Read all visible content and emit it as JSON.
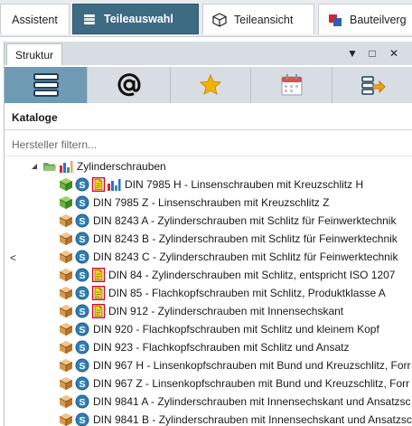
{
  "top_tabs": [
    {
      "label": "Assistent"
    },
    {
      "label": "Teileauswahl"
    },
    {
      "label": "Teileansicht"
    },
    {
      "label": "Bauteilverg"
    }
  ],
  "panel": {
    "tab_label": "Struktur",
    "controls": {
      "menu": "▼",
      "maximize": "□",
      "close": "✕"
    },
    "toolbar_icons": [
      "catalog-books-icon",
      "at-sign-icon",
      "favorites-star-icon",
      "calendar-icon",
      "export-arrow-icon"
    ],
    "section_label": "Kataloge",
    "filter_placeholder": "Hersteller filtern...",
    "scroll_left": "<"
  },
  "tree": {
    "root": {
      "label": "Zylinderschrauben"
    },
    "items": [
      {
        "label": "DIN 7985 H - Linsenschrauben mit Kreuzschlitz H",
        "cube": "green",
        "doc": true,
        "chart": true
      },
      {
        "label": "DIN 7985 Z - Linsenschrauben mit Kreuzschlitz Z",
        "cube": "green",
        "doc": false,
        "chart": false
      },
      {
        "label": "DIN 8243 A - Zylinderschrauben mit Schlitz für Feinwerktechnik",
        "cube": "orange",
        "doc": false,
        "chart": false
      },
      {
        "label": "DIN 8243 B - Zylinderschrauben mit Schlitz für Feinwerktechnik",
        "cube": "orange",
        "doc": false,
        "chart": false
      },
      {
        "label": "DIN 8243 C - Zylinderschrauben mit Schlitz für Feinwerktechnik",
        "cube": "orange",
        "doc": false,
        "chart": false
      },
      {
        "label": "DIN 84 - Zylinderschrauben mit Schlitz, entspricht ISO 1207",
        "cube": "orange",
        "doc": true,
        "chart": false
      },
      {
        "label": "DIN 85 - Flachkopfschrauben mit Schlitz, Produktklasse A",
        "cube": "orange",
        "doc": true,
        "chart": false
      },
      {
        "label": "DIN 912 - Zylinderschrauben mit Innensechskant",
        "cube": "orange",
        "doc": true,
        "chart": false
      },
      {
        "label": "DIN 920 - Flachkopfschrauben mit Schlitz und kleinem Kopf",
        "cube": "orange",
        "doc": false,
        "chart": false
      },
      {
        "label": "DIN 923 - Flachkopfschrauben mit Schlitz und Ansatz",
        "cube": "orange",
        "doc": false,
        "chart": false
      },
      {
        "label": "DIN 967 H - Linsenkopfschrauben mit Bund und Kreuzschlitz, Forr",
        "cube": "orange",
        "doc": false,
        "chart": false
      },
      {
        "label": "DIN 967 Z - Linsenkopfschrauben mit Bund und Kreuzschlitz, Forr",
        "cube": "orange",
        "doc": false,
        "chart": false
      },
      {
        "label": "DIN 9841 A - Zylinderschrauben mit Innensechskant und Ansatzsc",
        "cube": "orange",
        "doc": false,
        "chart": false
      },
      {
        "label": "DIN 9841 B - Zylinderschrauben mit Innensechskant und Ansatzsc",
        "cube": "orange",
        "doc": false,
        "chart": false
      }
    ]
  },
  "colors": {
    "active_tab": "#3e6b84",
    "active_toolbar_button": "#6f9ab3",
    "toolbar_bg": "#d7dde3",
    "highlight_border": "#e0001b"
  }
}
